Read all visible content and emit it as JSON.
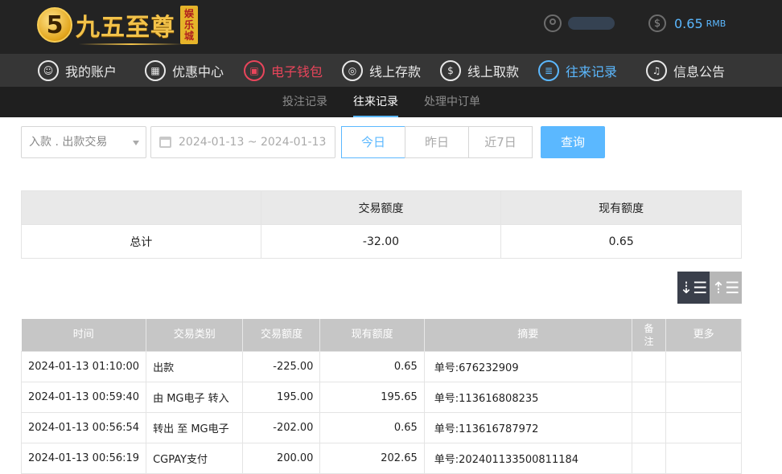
{
  "header": {
    "logo_number": "5",
    "logo_text": "九五至尊",
    "logo_badge": [
      "娱",
      "乐",
      "城"
    ],
    "balance": "0.65",
    "balance_unit": "RMB"
  },
  "nav": [
    {
      "label": "我的账户",
      "icon": "user-icon",
      "state": "normal"
    },
    {
      "label": "优惠中心",
      "icon": "gift-icon",
      "state": "normal"
    },
    {
      "label": "电子钱包",
      "icon": "wallet-icon",
      "state": "hot"
    },
    {
      "label": "线上存款",
      "icon": "deposit-icon",
      "state": "normal"
    },
    {
      "label": "线上取款",
      "icon": "withdraw-icon",
      "state": "normal"
    },
    {
      "label": "往来记录",
      "icon": "records-icon",
      "state": "active"
    },
    {
      "label": "信息公告",
      "icon": "bell-icon",
      "state": "normal"
    }
  ],
  "subnav": [
    {
      "label": "投注记录",
      "active": false
    },
    {
      "label": "往来记录",
      "active": true
    },
    {
      "label": "处理中订单",
      "active": false
    }
  ],
  "filters": {
    "type_select": "入款 . 出款交易",
    "date_range": "2024-01-13 ~ 2024-01-13",
    "today": "今日",
    "yesterday": "昨日",
    "last7": "近7日",
    "query": "查询"
  },
  "summary": {
    "col_trade": "交易额度",
    "col_current": "现有额度",
    "row_label": "总计",
    "trade_total": "-32.00",
    "current_total": "0.65"
  },
  "records": {
    "headers": [
      "时间",
      "交易类别",
      "交易额度",
      "现有额度",
      "摘要",
      "备注",
      "更多"
    ],
    "rows": [
      [
        "2024-01-13 01:10:00",
        "出款",
        "-225.00",
        "0.65",
        "单号:676232909",
        "",
        ""
      ],
      [
        "2024-01-13 00:59:40",
        "由 MG电子 转入",
        "195.00",
        "195.65",
        "单号:113616808235",
        "",
        ""
      ],
      [
        "2024-01-13 00:56:54",
        "转出 至 MG电子",
        "-202.00",
        "0.65",
        "单号:113616787972",
        "",
        ""
      ],
      [
        "2024-01-13 00:56:19",
        "CGPAY支付",
        "200.00",
        "202.65",
        "单号:202401133500811184",
        "",
        ""
      ]
    ]
  },
  "colors": {
    "accent": "#5bb8ff",
    "hot": "#e9455b",
    "header_bg": "#232323"
  }
}
